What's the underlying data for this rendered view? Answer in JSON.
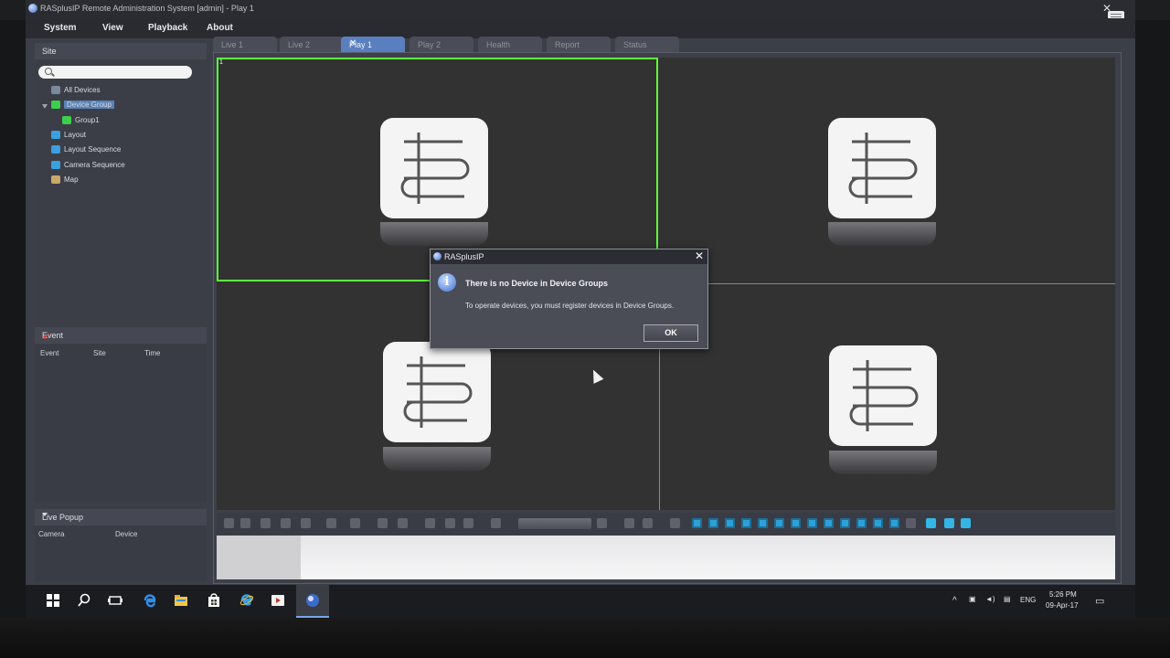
{
  "window": {
    "title": "RASplusIP Remote Administration System [admin] - Play 1",
    "close_glyph": "✕"
  },
  "menu": [
    "System",
    "View",
    "Playback",
    "About"
  ],
  "sidebar": {
    "site_header": "Site",
    "search_placeholder": "",
    "tree": [
      {
        "label": "All Devices",
        "icon": "devices-icon",
        "color": "#7a8a9c"
      },
      {
        "label": "Device Group",
        "icon": "device-group-icon",
        "color": "#3ccf4e",
        "selected": true
      },
      {
        "label": "Group1",
        "icon": "group-icon",
        "color": "#3ccf4e"
      },
      {
        "label": "Layout",
        "icon": "layout-icon",
        "color": "#3aa0e0"
      },
      {
        "label": "Layout Sequence",
        "icon": "layout-sequence-icon",
        "color": "#3aa0e0"
      },
      {
        "label": "Camera Sequence",
        "icon": "camera-sequence-icon",
        "color": "#3aa0e0"
      },
      {
        "label": "Map",
        "icon": "map-icon",
        "color": "#c9a96a"
      }
    ],
    "event_header": "Event",
    "event_columns": [
      "Event",
      "Site",
      "Time"
    ],
    "live_popup_header": "Live Popup",
    "live_popup_columns": [
      "Camera",
      "Device"
    ]
  },
  "tabs": [
    {
      "label": "Live 1",
      "active": false
    },
    {
      "label": "Live 2",
      "active": false
    },
    {
      "label": "Play 1",
      "active": true
    },
    {
      "label": "Play 2",
      "active": false
    },
    {
      "label": "Health",
      "active": false
    },
    {
      "label": "Report",
      "active": false
    },
    {
      "label": "Status",
      "active": false
    }
  ],
  "viewer": {
    "selected_cell_number": "1"
  },
  "dialog": {
    "title": "RASplusIP",
    "heading": "There is no Device in Device Groups",
    "message": "To operate devices, you must register devices in Device Groups.",
    "ok_label": "OK",
    "info_glyph": "i"
  },
  "taskbar": {
    "time": "5:26 PM",
    "date": "09-Apr-17",
    "language": "ENG"
  },
  "colors": {
    "selection_outline": "#5cff3c",
    "tab_active": "#5a7fbf",
    "accent_blue": "#33b6e5"
  }
}
